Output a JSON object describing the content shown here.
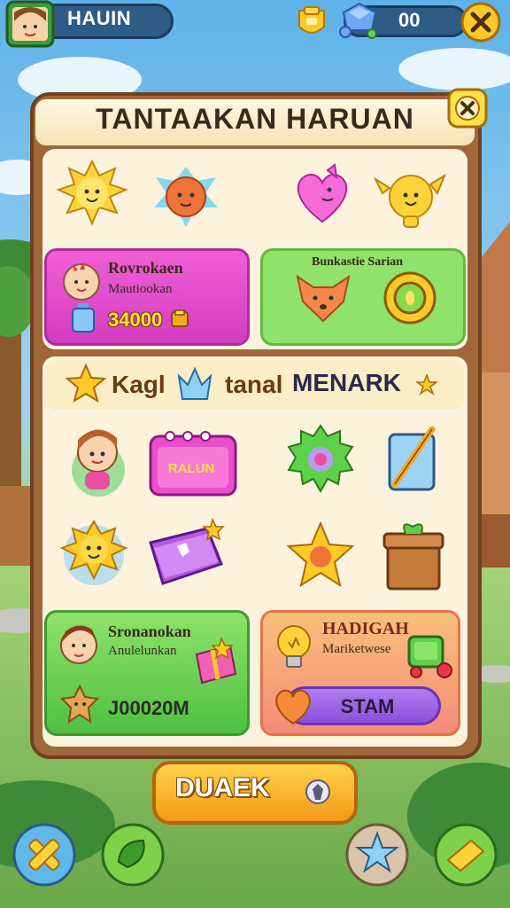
{
  "top_bar": {
    "player_name": "HAUIN",
    "gem_count": "00"
  },
  "panel": {
    "title": "TANTAAKAN HARUAN"
  },
  "card_pink": {
    "title": "Rovrokaen",
    "subtitle": "Mautiookan",
    "amount": "34000"
  },
  "card_green_top": {
    "title": "Bunkastie Sarian"
  },
  "banner": {
    "left_text": "Kagl",
    "middle_text": "tanal",
    "main_text": "MENARK"
  },
  "calendar": {
    "label": "RALUN"
  },
  "card_green_bottom": {
    "title": "Sronanokan",
    "subtitle": "Anulelunkan",
    "amount": "J00020M"
  },
  "card_orange": {
    "title": "HADIGAH",
    "subtitle": "Mariketwese",
    "button_label": "STAM"
  },
  "claim_button": {
    "label": "DUAEK"
  },
  "icons": [
    "avatar-icon",
    "badge-icon",
    "gem-icon",
    "close-icon",
    "sun-mascot-icon",
    "fox-mascot-icon",
    "heart-cat-icon",
    "chick-mascot-icon",
    "baby-icon",
    "potion-icon",
    "coin-icon",
    "fox-face-icon",
    "gold-ring-icon",
    "crown-icon",
    "star-icon",
    "girl-icon",
    "calendar-icon",
    "green-gear-icon",
    "pencil-card-icon",
    "sun-face-icon",
    "book-icon",
    "gold-star-icon",
    "gift-box-icon",
    "boy-icon",
    "gift-icon",
    "cookie-icon",
    "bulb-icon",
    "green-tool-icon",
    "heart-icon",
    "gem-small-icon",
    "crossed-tools-icon",
    "leaf-icon",
    "blue-star-icon",
    "gold-bar-icon"
  ],
  "colors": {
    "panel_frame": "#a0683a",
    "panel_inner": "#fdf3dd",
    "card_pink": "#e84fcf",
    "card_green": "#8fe26a",
    "card_orange": "#fbb07a",
    "claim_button": "#f9b52a",
    "top_pill": "#2f5c86"
  }
}
